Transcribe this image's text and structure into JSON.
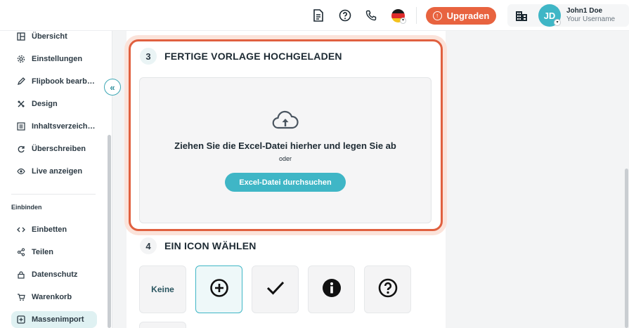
{
  "topbar": {
    "icons": [
      "document-icon",
      "help-icon",
      "phone-icon"
    ],
    "language_flag": "de-flag",
    "upgrade_label": "Upgraden",
    "user": {
      "initials": "JD",
      "name": "John1 Doe",
      "subtitle": "Your Username"
    }
  },
  "sidebar": {
    "items": [
      {
        "label": "Übersicht",
        "icon": "layout-icon"
      },
      {
        "label": "Einstellungen",
        "icon": "gear-icon"
      },
      {
        "label": "Flipbook bearb…",
        "icon": "pencil-icon"
      },
      {
        "label": "Design",
        "icon": "design-tools-icon"
      },
      {
        "label": "Inhaltsverzeich…",
        "icon": "list-icon"
      },
      {
        "label": "Überschreiben",
        "icon": "refresh-icon"
      },
      {
        "label": "Live anzeigen",
        "icon": "eye-icon"
      }
    ],
    "section_label": "Einbinden",
    "embed_items": [
      {
        "label": "Einbetten",
        "icon": "code-icon"
      },
      {
        "label": "Teilen",
        "icon": "share-icon"
      },
      {
        "label": "Datenschutz",
        "icon": "lock-icon"
      },
      {
        "label": "Warenkorb",
        "icon": "cart-icon"
      },
      {
        "label": "Massenimport",
        "icon": "import-icon",
        "active": true
      }
    ],
    "collapse_glyph": "«"
  },
  "main": {
    "step3": {
      "number": "3",
      "title": "FERTIGE VORLAGE HOCHGELADEN",
      "drop_text": "Ziehen Sie die Excel-Datei hierher und legen Sie ab",
      "or_text": "oder",
      "browse_label": "Excel-Datei durchsuchen"
    },
    "step4": {
      "number": "4",
      "title": "EIN ICON WÄHLEN",
      "options": [
        {
          "label": "Keine",
          "icon": null
        },
        {
          "label": "",
          "icon": "plus-circle-icon",
          "selected": true
        },
        {
          "label": "",
          "icon": "checkmark-icon"
        },
        {
          "label": "",
          "icon": "info-icon"
        },
        {
          "label": "",
          "icon": "question-circle-icon"
        }
      ]
    }
  },
  "colors": {
    "accent": "#3fb6c6",
    "upgrade": "#e8633f",
    "highlight_border": "#e0603f"
  }
}
